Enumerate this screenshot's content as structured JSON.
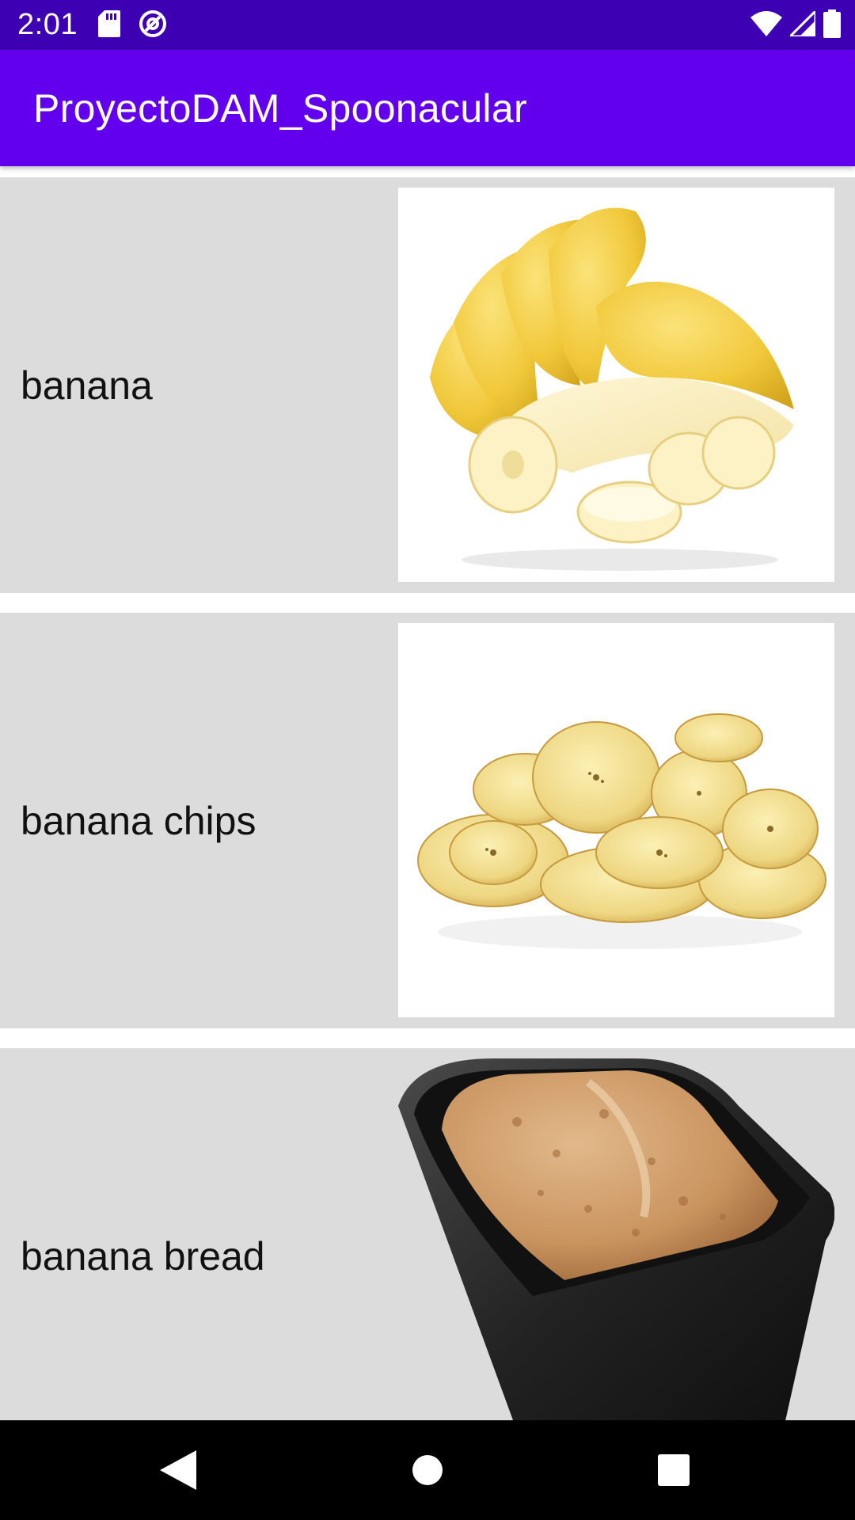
{
  "status_bar": {
    "time": "2:01",
    "left_icons": [
      "sd-card-icon",
      "sync-icon"
    ],
    "right_icons": [
      "wifi-icon",
      "signal-icon",
      "battery-icon"
    ],
    "background": "#3d00b3"
  },
  "app_bar": {
    "title": "ProyectoDAM_Spoonacular",
    "background": "#6200ee"
  },
  "list": {
    "items": [
      {
        "label": "banana",
        "image": "banana-image"
      },
      {
        "label": "banana chips",
        "image": "banana-chips-image"
      },
      {
        "label": "banana bread",
        "image": "banana-bread-image"
      }
    ]
  },
  "nav_bar": {
    "buttons": [
      "back-icon",
      "home-icon",
      "recents-icon"
    ]
  }
}
